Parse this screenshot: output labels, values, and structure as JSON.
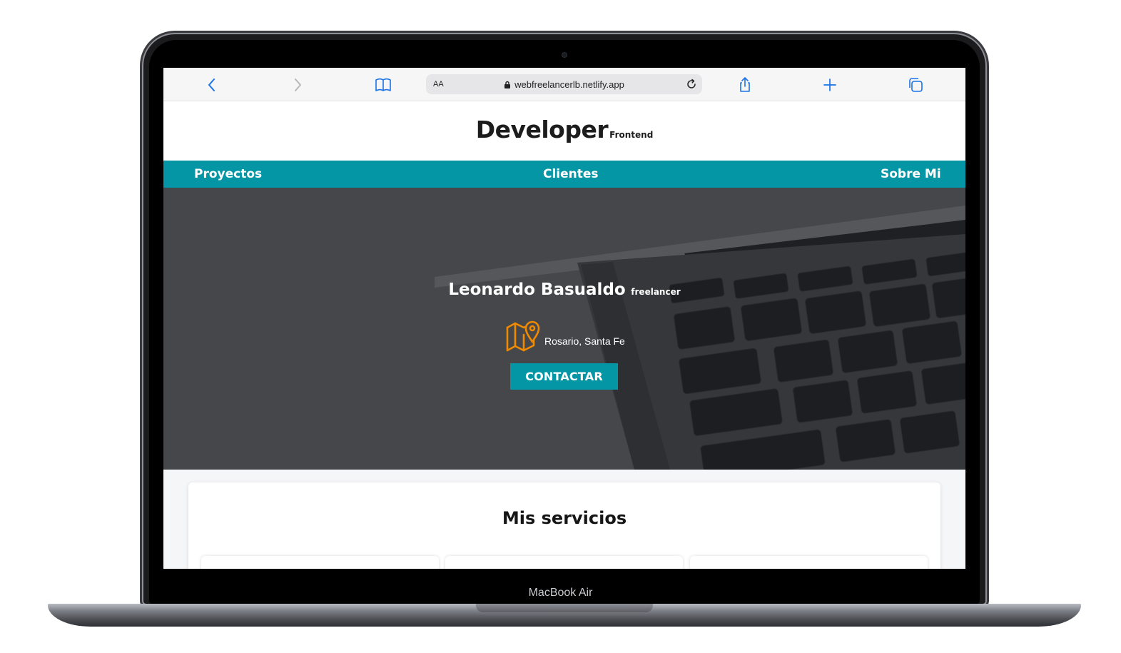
{
  "device": {
    "label": "MacBook Air"
  },
  "browser": {
    "aa_label": "AA",
    "url": "webfreelancerlb.netlify.app",
    "icons": [
      "back-icon",
      "forward-icon",
      "bookmarks-icon",
      "lock-icon",
      "reload-icon",
      "share-icon",
      "new-tab-icon",
      "tabs-icon"
    ]
  },
  "header": {
    "title": "Developer",
    "subtitle": "Frontend"
  },
  "nav": {
    "items": [
      "Proyectos",
      "Clientes",
      "Sobre Mi"
    ]
  },
  "hero": {
    "name": "Leonardo Basualdo",
    "tag": "freelancer",
    "location": "Rosario, Santa Fe",
    "cta_label": "CONTACTAR",
    "icon": "map-pin-icon"
  },
  "services": {
    "title": "Mis servicios"
  },
  "colors": {
    "accent": "#0596a6",
    "icon_orange": "#f08a00",
    "hero_bg": "#46474b"
  }
}
